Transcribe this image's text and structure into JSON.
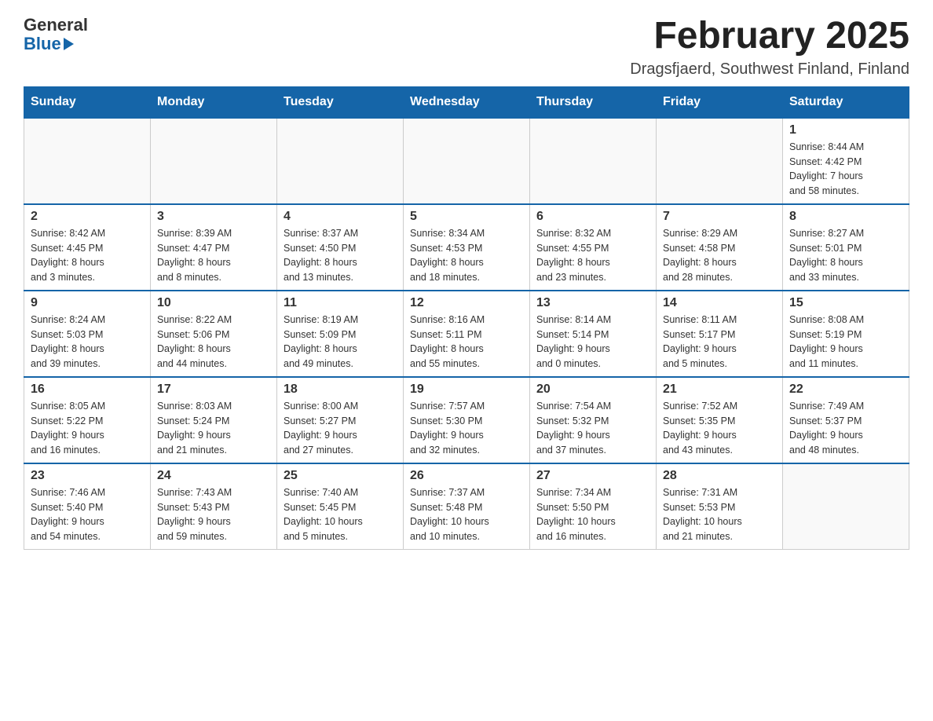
{
  "header": {
    "logo_line1": "General",
    "logo_line2": "Blue",
    "month_title": "February 2025",
    "location": "Dragsfjaerd, Southwest Finland, Finland"
  },
  "weekdays": [
    "Sunday",
    "Monday",
    "Tuesday",
    "Wednesday",
    "Thursday",
    "Friday",
    "Saturday"
  ],
  "weeks": [
    [
      {
        "day": "",
        "info": ""
      },
      {
        "day": "",
        "info": ""
      },
      {
        "day": "",
        "info": ""
      },
      {
        "day": "",
        "info": ""
      },
      {
        "day": "",
        "info": ""
      },
      {
        "day": "",
        "info": ""
      },
      {
        "day": "1",
        "info": "Sunrise: 8:44 AM\nSunset: 4:42 PM\nDaylight: 7 hours\nand 58 minutes."
      }
    ],
    [
      {
        "day": "2",
        "info": "Sunrise: 8:42 AM\nSunset: 4:45 PM\nDaylight: 8 hours\nand 3 minutes."
      },
      {
        "day": "3",
        "info": "Sunrise: 8:39 AM\nSunset: 4:47 PM\nDaylight: 8 hours\nand 8 minutes."
      },
      {
        "day": "4",
        "info": "Sunrise: 8:37 AM\nSunset: 4:50 PM\nDaylight: 8 hours\nand 13 minutes."
      },
      {
        "day": "5",
        "info": "Sunrise: 8:34 AM\nSunset: 4:53 PM\nDaylight: 8 hours\nand 18 minutes."
      },
      {
        "day": "6",
        "info": "Sunrise: 8:32 AM\nSunset: 4:55 PM\nDaylight: 8 hours\nand 23 minutes."
      },
      {
        "day": "7",
        "info": "Sunrise: 8:29 AM\nSunset: 4:58 PM\nDaylight: 8 hours\nand 28 minutes."
      },
      {
        "day": "8",
        "info": "Sunrise: 8:27 AM\nSunset: 5:01 PM\nDaylight: 8 hours\nand 33 minutes."
      }
    ],
    [
      {
        "day": "9",
        "info": "Sunrise: 8:24 AM\nSunset: 5:03 PM\nDaylight: 8 hours\nand 39 minutes."
      },
      {
        "day": "10",
        "info": "Sunrise: 8:22 AM\nSunset: 5:06 PM\nDaylight: 8 hours\nand 44 minutes."
      },
      {
        "day": "11",
        "info": "Sunrise: 8:19 AM\nSunset: 5:09 PM\nDaylight: 8 hours\nand 49 minutes."
      },
      {
        "day": "12",
        "info": "Sunrise: 8:16 AM\nSunset: 5:11 PM\nDaylight: 8 hours\nand 55 minutes."
      },
      {
        "day": "13",
        "info": "Sunrise: 8:14 AM\nSunset: 5:14 PM\nDaylight: 9 hours\nand 0 minutes."
      },
      {
        "day": "14",
        "info": "Sunrise: 8:11 AM\nSunset: 5:17 PM\nDaylight: 9 hours\nand 5 minutes."
      },
      {
        "day": "15",
        "info": "Sunrise: 8:08 AM\nSunset: 5:19 PM\nDaylight: 9 hours\nand 11 minutes."
      }
    ],
    [
      {
        "day": "16",
        "info": "Sunrise: 8:05 AM\nSunset: 5:22 PM\nDaylight: 9 hours\nand 16 minutes."
      },
      {
        "day": "17",
        "info": "Sunrise: 8:03 AM\nSunset: 5:24 PM\nDaylight: 9 hours\nand 21 minutes."
      },
      {
        "day": "18",
        "info": "Sunrise: 8:00 AM\nSunset: 5:27 PM\nDaylight: 9 hours\nand 27 minutes."
      },
      {
        "day": "19",
        "info": "Sunrise: 7:57 AM\nSunset: 5:30 PM\nDaylight: 9 hours\nand 32 minutes."
      },
      {
        "day": "20",
        "info": "Sunrise: 7:54 AM\nSunset: 5:32 PM\nDaylight: 9 hours\nand 37 minutes."
      },
      {
        "day": "21",
        "info": "Sunrise: 7:52 AM\nSunset: 5:35 PM\nDaylight: 9 hours\nand 43 minutes."
      },
      {
        "day": "22",
        "info": "Sunrise: 7:49 AM\nSunset: 5:37 PM\nDaylight: 9 hours\nand 48 minutes."
      }
    ],
    [
      {
        "day": "23",
        "info": "Sunrise: 7:46 AM\nSunset: 5:40 PM\nDaylight: 9 hours\nand 54 minutes."
      },
      {
        "day": "24",
        "info": "Sunrise: 7:43 AM\nSunset: 5:43 PM\nDaylight: 9 hours\nand 59 minutes."
      },
      {
        "day": "25",
        "info": "Sunrise: 7:40 AM\nSunset: 5:45 PM\nDaylight: 10 hours\nand 5 minutes."
      },
      {
        "day": "26",
        "info": "Sunrise: 7:37 AM\nSunset: 5:48 PM\nDaylight: 10 hours\nand 10 minutes."
      },
      {
        "day": "27",
        "info": "Sunrise: 7:34 AM\nSunset: 5:50 PM\nDaylight: 10 hours\nand 16 minutes."
      },
      {
        "day": "28",
        "info": "Sunrise: 7:31 AM\nSunset: 5:53 PM\nDaylight: 10 hours\nand 21 minutes."
      },
      {
        "day": "",
        "info": ""
      }
    ]
  ]
}
